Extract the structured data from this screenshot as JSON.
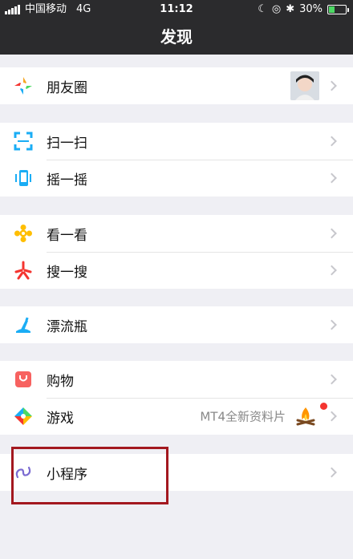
{
  "status_bar": {
    "carrier": "中国移动",
    "network": "4G",
    "time": "11:12",
    "battery": "30%",
    "battery_level": 0.3
  },
  "nav": {
    "title": "发现"
  },
  "groups": [
    {
      "items": [
        {
          "id": "moments",
          "label": "朋友圈",
          "icon": "moments-icon",
          "has_avatar": true
        }
      ]
    },
    {
      "items": [
        {
          "id": "scan",
          "label": "扫一扫",
          "icon": "scan-icon"
        },
        {
          "id": "shake",
          "label": "摇一摇",
          "icon": "shake-icon"
        }
      ]
    },
    {
      "items": [
        {
          "id": "top-stories",
          "label": "看一看",
          "icon": "top-stories-icon"
        },
        {
          "id": "search",
          "label": "搜一搜",
          "icon": "search-icon"
        }
      ]
    },
    {
      "items": [
        {
          "id": "bottle",
          "label": "漂流瓶",
          "icon": "bottle-icon"
        }
      ]
    },
    {
      "items": [
        {
          "id": "shopping",
          "label": "购物",
          "icon": "shopping-icon"
        },
        {
          "id": "games",
          "label": "游戏",
          "icon": "games-icon",
          "extra": "MT4全新资料片",
          "has_badge": true
        }
      ]
    },
    {
      "items": [
        {
          "id": "mini-programs",
          "label": "小程序",
          "icon": "mini-program-icon",
          "highlighted": true
        }
      ]
    }
  ]
}
